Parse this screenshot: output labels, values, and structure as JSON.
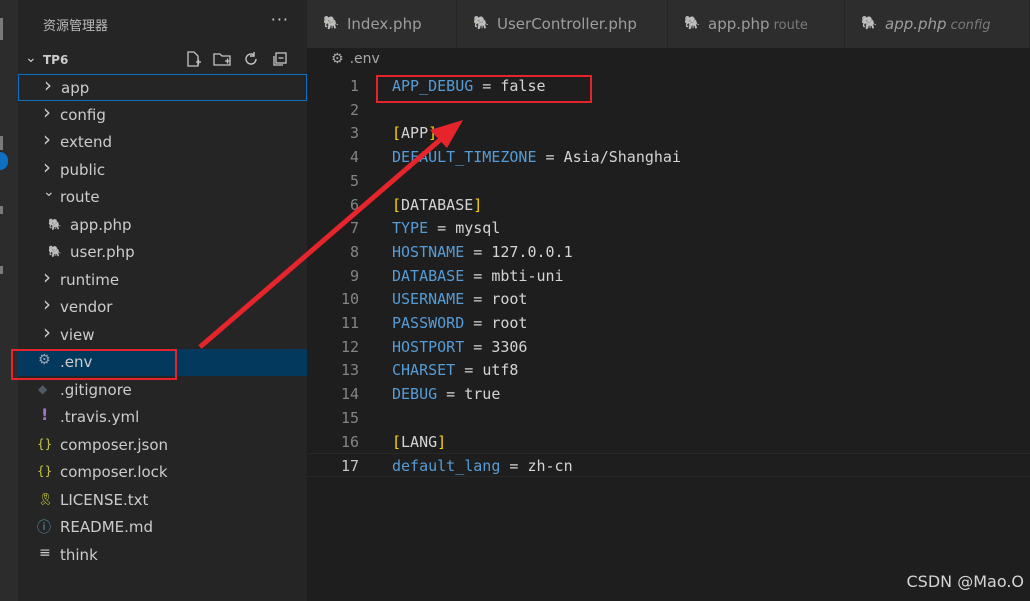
{
  "explorer": {
    "title": "资源管理器",
    "more_label": "···",
    "project_name": "TP6",
    "actions": [
      "new-file-icon",
      "new-folder-icon",
      "refresh-icon",
      "collapse-all-icon"
    ]
  },
  "tree": [
    {
      "label": "app",
      "kind": "folder-collapsed"
    },
    {
      "label": "config",
      "kind": "folder-collapsed"
    },
    {
      "label": "extend",
      "kind": "folder-collapsed"
    },
    {
      "label": "public",
      "kind": "folder-collapsed"
    },
    {
      "label": "route",
      "kind": "folder-expanded"
    },
    {
      "label": "app.php",
      "kind": "php-file"
    },
    {
      "label": "user.php",
      "kind": "php-file"
    },
    {
      "label": "runtime",
      "kind": "folder-collapsed"
    },
    {
      "label": "vendor",
      "kind": "folder-collapsed"
    },
    {
      "label": "view",
      "kind": "folder-collapsed"
    },
    {
      "label": ".env",
      "kind": "settings-file"
    },
    {
      "label": ".gitignore",
      "kind": "git-file"
    },
    {
      "label": ".travis.yml",
      "kind": "yaml-file"
    },
    {
      "label": "composer.json",
      "kind": "json-file"
    },
    {
      "label": "composer.lock",
      "kind": "json-file"
    },
    {
      "label": "LICENSE.txt",
      "kind": "license-file"
    },
    {
      "label": "README.md",
      "kind": "info-file"
    },
    {
      "label": "think",
      "kind": "text-file"
    }
  ],
  "tabs": [
    {
      "label": "Index.php",
      "desc": "",
      "italic": false
    },
    {
      "label": "UserController.php",
      "desc": "",
      "italic": false
    },
    {
      "label": "app.php",
      "desc": "route",
      "italic": false
    },
    {
      "label": "app.php",
      "desc": "config",
      "italic": true
    }
  ],
  "breadcrumb": {
    "file": ".env"
  },
  "editor": {
    "current_line": 17,
    "lines": [
      {
        "n": "1",
        "key": "APP_DEBUG",
        "op": " = ",
        "val": "false",
        "section": ""
      },
      {
        "n": "2",
        "key": "",
        "op": "",
        "val": "",
        "section": ""
      },
      {
        "n": "3",
        "key": "",
        "op": "",
        "val": "",
        "section": "APP"
      },
      {
        "n": "4",
        "key": "DEFAULT_TIMEZONE",
        "op": " = ",
        "val": "Asia/Shanghai",
        "section": ""
      },
      {
        "n": "5",
        "key": "",
        "op": "",
        "val": "",
        "section": ""
      },
      {
        "n": "6",
        "key": "",
        "op": "",
        "val": "",
        "section": "DATABASE"
      },
      {
        "n": "7",
        "key": "TYPE",
        "op": " = ",
        "val": "mysql",
        "section": ""
      },
      {
        "n": "8",
        "key": "HOSTNAME",
        "op": " = ",
        "val": "127.0.0.1",
        "section": ""
      },
      {
        "n": "9",
        "key": "DATABASE",
        "op": " = ",
        "val": "mbti-uni",
        "section": ""
      },
      {
        "n": "10",
        "key": "USERNAME",
        "op": " = ",
        "val": "root",
        "section": ""
      },
      {
        "n": "11",
        "key": "PASSWORD",
        "op": " = ",
        "val": "root",
        "section": ""
      },
      {
        "n": "12",
        "key": "HOSTPORT",
        "op": " = ",
        "val": "3306",
        "section": ""
      },
      {
        "n": "13",
        "key": "CHARSET",
        "op": " = ",
        "val": "utf8",
        "section": ""
      },
      {
        "n": "14",
        "key": "DEBUG",
        "op": " = ",
        "val": "true",
        "section": ""
      },
      {
        "n": "15",
        "key": "",
        "op": "",
        "val": "",
        "section": ""
      },
      {
        "n": "16",
        "key": "",
        "op": "",
        "val": "",
        "section": "LANG"
      },
      {
        "n": "17",
        "key": "default_lang",
        "op": " = ",
        "val": "zh-cn",
        "section": ""
      }
    ]
  },
  "annotations": {
    "highlight_color": "#e5242b"
  },
  "watermark": "CSDN @Mao.O"
}
